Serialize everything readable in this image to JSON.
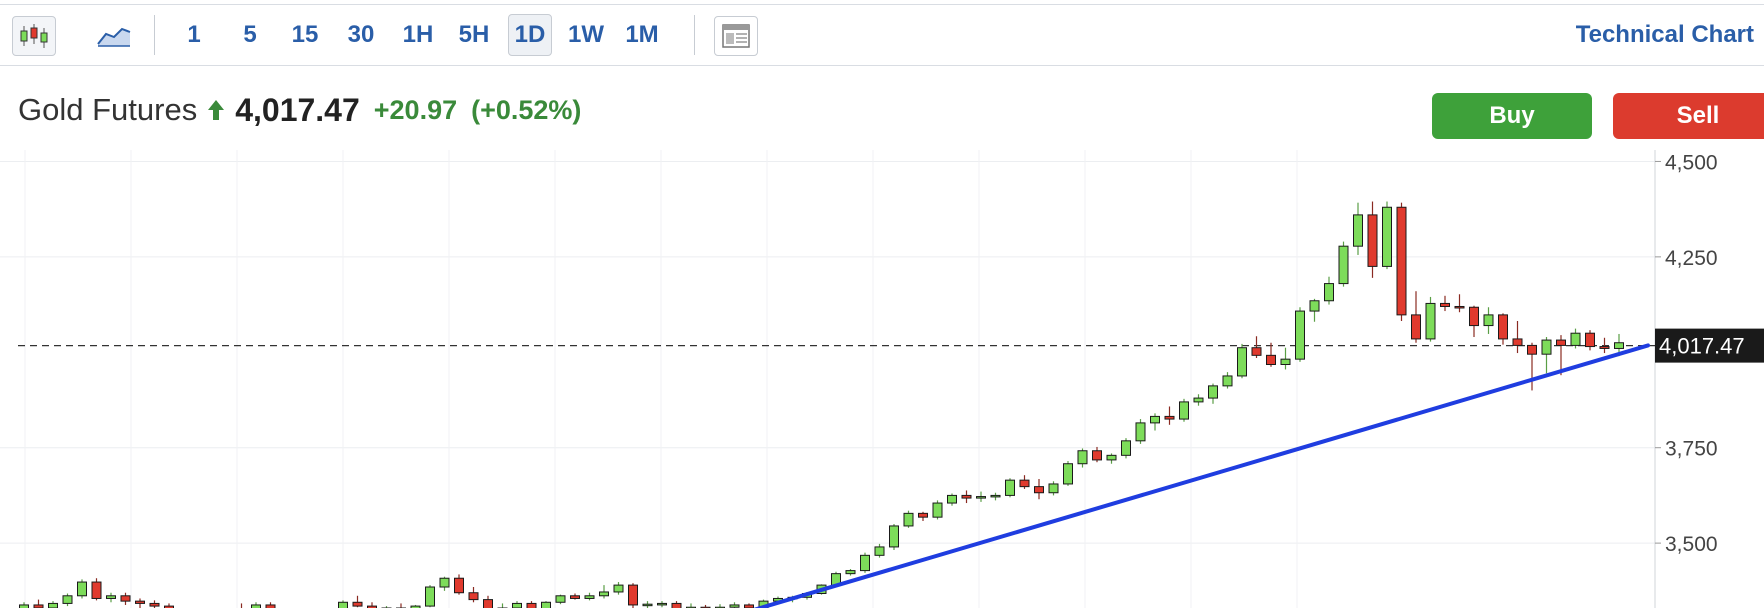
{
  "toolbar": {
    "intervals": [
      "1",
      "5",
      "15",
      "30",
      "1H",
      "5H",
      "1D",
      "1W",
      "1M"
    ],
    "selected_interval": "1D",
    "title": "Technical Chart",
    "link_color": "#2a5ea8"
  },
  "quote": {
    "name": "Gold Futures",
    "direction_icon": "arrow-up-icon",
    "price": "4,017.47",
    "change": "+20.97",
    "change_pct": "(+0.52%)",
    "up_color": "#3a8a3a"
  },
  "actions": {
    "buy_label": "Buy",
    "sell_label": "Sell",
    "buy_color": "#3ea13a",
    "sell_color": "#dc3b2e"
  },
  "chart_data": {
    "type": "candlestick",
    "interval": "1D",
    "y_ticks": [
      "4,500",
      "4,250",
      "3,750",
      "3,500"
    ],
    "y_tick_values": [
      4500,
      4250,
      3750,
      3500
    ],
    "ylim": [
      3330,
      4530
    ],
    "grid": true,
    "last_price_label": "4,017.47",
    "last_price": 4017.47,
    "up_color": "#7ddc5a",
    "down_color": "#e03a2e",
    "trendline_color": "#1f3de0",
    "trendline": {
      "start_bar": 49,
      "start_price": 3310,
      "end_bar": 112,
      "end_price": 4018
    },
    "candles": [
      [
        3322,
        3345,
        3310,
        3338
      ],
      [
        3338,
        3352,
        3325,
        3330
      ],
      [
        3330,
        3348,
        3318,
        3342
      ],
      [
        3342,
        3368,
        3335,
        3362
      ],
      [
        3362,
        3405,
        3355,
        3398
      ],
      [
        3398,
        3408,
        3350,
        3355
      ],
      [
        3355,
        3370,
        3345,
        3362
      ],
      [
        3362,
        3370,
        3338,
        3348
      ],
      [
        3348,
        3355,
        3330,
        3342
      ],
      [
        3342,
        3350,
        3328,
        3335
      ],
      [
        3335,
        3342,
        3318,
        3325
      ],
      [
        3325,
        3330,
        3295,
        3302
      ],
      [
        3302,
        3312,
        3290,
        3305
      ],
      [
        3305,
        3310,
        3292,
        3298
      ],
      [
        3298,
        3330,
        3295,
        3325
      ],
      [
        3325,
        3342,
        3318,
        3322
      ],
      [
        3322,
        3345,
        3315,
        3338
      ],
      [
        3338,
        3345,
        3310,
        3315
      ],
      [
        3315,
        3328,
        3310,
        3325
      ],
      [
        3325,
        3330,
        3305,
        3310
      ],
      [
        3310,
        3322,
        3300,
        3318
      ],
      [
        3318,
        3330,
        3312,
        3325
      ],
      [
        3325,
        3350,
        3320,
        3345
      ],
      [
        3345,
        3362,
        3332,
        3335
      ],
      [
        3335,
        3345,
        3312,
        3318
      ],
      [
        3318,
        3335,
        3310,
        3330
      ],
      [
        3330,
        3342,
        3322,
        3325
      ],
      [
        3325,
        3338,
        3320,
        3335
      ],
      [
        3335,
        3390,
        3332,
        3385
      ],
      [
        3385,
        3412,
        3375,
        3408
      ],
      [
        3408,
        3418,
        3365,
        3370
      ],
      [
        3370,
        3385,
        3345,
        3352
      ],
      [
        3352,
        3362,
        3320,
        3325
      ],
      [
        3325,
        3342,
        3318,
        3330
      ],
      [
        3330,
        3348,
        3325,
        3342
      ],
      [
        3342,
        3348,
        3300,
        3310
      ],
      [
        3310,
        3348,
        3305,
        3345
      ],
      [
        3345,
        3365,
        3340,
        3362
      ],
      [
        3362,
        3368,
        3352,
        3355
      ],
      [
        3355,
        3370,
        3350,
        3362
      ],
      [
        3362,
        3390,
        3355,
        3372
      ],
      [
        3372,
        3398,
        3365,
        3390
      ],
      [
        3390,
        3395,
        3330,
        3338
      ],
      [
        3338,
        3348,
        3325,
        3340
      ],
      [
        3340,
        3348,
        3332,
        3342
      ],
      [
        3342,
        3348,
        3318,
        3322
      ],
      [
        3322,
        3342,
        3315,
        3332
      ],
      [
        3332,
        3338,
        3315,
        3320
      ],
      [
        3320,
        3340,
        3312,
        3332
      ],
      [
        3332,
        3345,
        3325,
        3338
      ],
      [
        3338,
        3342,
        3322,
        3330
      ],
      [
        3330,
        3352,
        3325,
        3348
      ],
      [
        3348,
        3360,
        3340,
        3355
      ],
      [
        3355,
        3362,
        3345,
        3358
      ],
      [
        3358,
        3372,
        3352,
        3368
      ],
      [
        3368,
        3392,
        3365,
        3390
      ],
      [
        3390,
        3425,
        3385,
        3420
      ],
      [
        3420,
        3432,
        3415,
        3428
      ],
      [
        3428,
        3475,
        3422,
        3468
      ],
      [
        3468,
        3498,
        3462,
        3490
      ],
      [
        3490,
        3550,
        3482,
        3545
      ],
      [
        3545,
        3585,
        3540,
        3578
      ],
      [
        3578,
        3582,
        3558,
        3568
      ],
      [
        3568,
        3612,
        3562,
        3605
      ],
      [
        3605,
        3630,
        3598,
        3625
      ],
      [
        3625,
        3638,
        3605,
        3618
      ],
      [
        3618,
        3635,
        3608,
        3622
      ],
      [
        3622,
        3632,
        3612,
        3625
      ],
      [
        3625,
        3670,
        3620,
        3665
      ],
      [
        3665,
        3678,
        3642,
        3648
      ],
      [
        3648,
        3668,
        3615,
        3632
      ],
      [
        3632,
        3662,
        3625,
        3655
      ],
      [
        3655,
        3715,
        3650,
        3708
      ],
      [
        3708,
        3748,
        3698,
        3742
      ],
      [
        3742,
        3752,
        3712,
        3718
      ],
      [
        3718,
        3735,
        3708,
        3730
      ],
      [
        3730,
        3775,
        3722,
        3768
      ],
      [
        3768,
        3825,
        3760,
        3815
      ],
      [
        3815,
        3840,
        3795,
        3832
      ],
      [
        3832,
        3858,
        3810,
        3825
      ],
      [
        3825,
        3878,
        3818,
        3870
      ],
      [
        3870,
        3890,
        3860,
        3880
      ],
      [
        3880,
        3918,
        3865,
        3912
      ],
      [
        3912,
        3948,
        3905,
        3938
      ],
      [
        3938,
        4022,
        3932,
        4012
      ],
      [
        4012,
        4042,
        3985,
        3992
      ],
      [
        3992,
        4025,
        3962,
        3968
      ],
      [
        3968,
        4012,
        3955,
        3982
      ],
      [
        3982,
        4118,
        3975,
        4108
      ],
      [
        4108,
        4140,
        4080,
        4135
      ],
      [
        4135,
        4198,
        4125,
        4180
      ],
      [
        4180,
        4290,
        4172,
        4278
      ],
      [
        4278,
        4392,
        4255,
        4360
      ],
      [
        4360,
        4395,
        4195,
        4225
      ],
      [
        4225,
        4395,
        4218,
        4380
      ],
      [
        4380,
        4392,
        4082,
        4098
      ],
      [
        4098,
        4160,
        4025,
        4035
      ],
      [
        4035,
        4145,
        4028,
        4128
      ],
      [
        4128,
        4148,
        4108,
        4120
      ],
      [
        4120,
        4152,
        4105,
        4118
      ],
      [
        4118,
        4122,
        4040,
        4070
      ],
      [
        4070,
        4118,
        4048,
        4098
      ],
      [
        4098,
        4102,
        4020,
        4035
      ],
      [
        4035,
        4082,
        3998,
        4018
      ],
      [
        4018,
        4025,
        3900,
        3995
      ],
      [
        3995,
        4040,
        3945,
        4032
      ],
      [
        4032,
        4045,
        3940,
        4018
      ],
      [
        4018,
        4062,
        4010,
        4050
      ],
      [
        4050,
        4058,
        4005,
        4015
      ],
      [
        4015,
        4038,
        3998,
        4010
      ],
      [
        4010,
        4048,
        3990,
        4025
      ]
    ]
  }
}
